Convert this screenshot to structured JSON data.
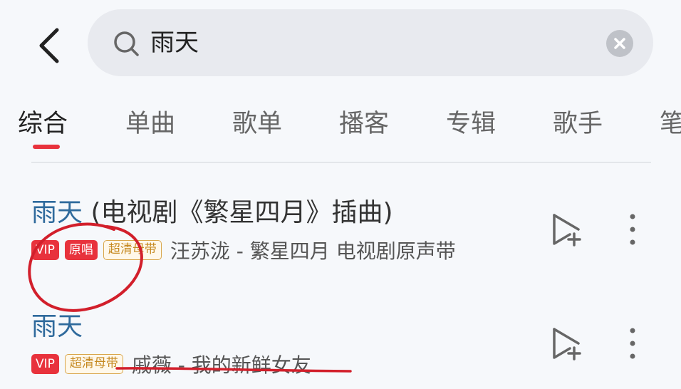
{
  "search": {
    "query": "雨天"
  },
  "tabs": [
    {
      "label": "综合",
      "active": true
    },
    {
      "label": "单曲"
    },
    {
      "label": "歌单"
    },
    {
      "label": "播客"
    },
    {
      "label": "专辑"
    },
    {
      "label": "歌手"
    },
    {
      "label": "笔"
    }
  ],
  "songs": [
    {
      "title": "雨天",
      "subtitle": " (电视剧《繁星四月》插曲)",
      "badges": {
        "vip": "VIP",
        "original": "原唱",
        "hq": "超清母带"
      },
      "artist_album": "汪苏泷 - 繁星四月 电视剧原声带"
    },
    {
      "title": "雨天",
      "subtitle": "",
      "badges": {
        "vip": "VIP",
        "hq": "超清母带"
      },
      "artist_album": "戚薇 - 我的新鲜女友"
    }
  ],
  "colors": {
    "accent": "#e8323c",
    "title_blue": "#2f6a9c",
    "hq_gold": "#c68a22"
  },
  "icons": [
    "back-arrow-icon",
    "search-icon",
    "clear-icon",
    "add-to-playlist-icon",
    "more-vertical-icon"
  ]
}
